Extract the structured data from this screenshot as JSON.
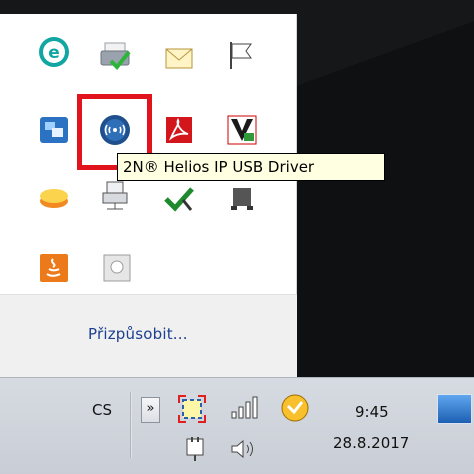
{
  "overflow_panel": {
    "icons": [
      {
        "name": "eset-icon",
        "row": 0,
        "col": 0
      },
      {
        "name": "printer-ok-icon",
        "row": 0,
        "col": 1
      },
      {
        "name": "mail-icon",
        "row": 0,
        "col": 2
      },
      {
        "name": "flag-icon",
        "row": 0,
        "col": 3
      },
      {
        "name": "remote-desktop-icon",
        "row": 1,
        "col": 0
      },
      {
        "name": "helios-usb-driver-icon",
        "row": 1,
        "col": 1
      },
      {
        "name": "adobe-acrobat-icon",
        "row": 1,
        "col": 2
      },
      {
        "name": "vlc-like-app-icon",
        "row": 1,
        "col": 3
      },
      {
        "name": "cheese-app-icon",
        "row": 2,
        "col": 0
      },
      {
        "name": "network-share-icon",
        "row": 2,
        "col": 1
      },
      {
        "name": "sync-ok-icon",
        "row": 2,
        "col": 2
      },
      {
        "name": "usb-device-icon",
        "row": 2,
        "col": 3
      },
      {
        "name": "java-icon",
        "row": 3,
        "col": 0
      },
      {
        "name": "disk-icon",
        "row": 3,
        "col": 1
      }
    ],
    "tooltip": "2N® Helios IP USB Driver",
    "customize_label": "Přizpůsobit..."
  },
  "taskbar": {
    "language": "CS",
    "expand_glyph": "»",
    "time": "9:45",
    "date": "28.8.2017"
  },
  "colors": {
    "selection": "#e1141d",
    "tooltip_bg": "#ffffe1",
    "link": "#1d3f8f"
  }
}
